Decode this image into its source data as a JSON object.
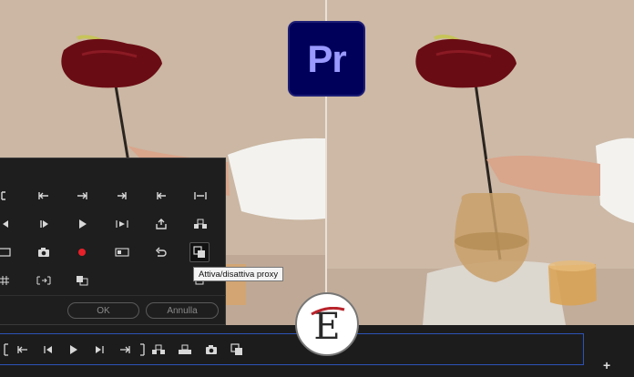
{
  "app_logo": {
    "text": "Pr",
    "bg_color": "#00005b",
    "fg_color": "#9999ff"
  },
  "watermark": {
    "letter": "E"
  },
  "dialog": {
    "ok_label": "OK",
    "cancel_label": "Annulla",
    "record_color": "#e8202a"
  },
  "tooltip": {
    "text": "Attiva/disattiva proxy"
  },
  "icons": {
    "row1": [
      "mark-in-icon",
      "go-to-in-icon",
      "go-to-out-icon",
      "mark-out-icon",
      "step-back-icon",
      "clear-in-out-icon"
    ],
    "row2": [
      "play-left-icon",
      "step-forward-icon",
      "play-icon",
      "play-in-to-out-icon",
      "export-frame-icon",
      "insert-icon"
    ],
    "row3": [
      "safe-margins-icon",
      "camera-icon",
      "record-icon",
      "multi-camera-icon",
      "undo-icon",
      "proxy-toggle-icon"
    ],
    "row4": [
      "grid-icon",
      "comparison-view-icon",
      "overlay-icon",
      "blank-icon"
    ]
  },
  "transport": [
    "mark-in-icon",
    "mark-out-icon",
    "go-to-in-icon",
    "step-back-icon",
    "play-icon",
    "step-forward-icon",
    "go-to-out-icon",
    "marker-icon",
    "insert-icon",
    "overwrite-icon",
    "export-frame-icon",
    "proxy-toggle-icon"
  ]
}
